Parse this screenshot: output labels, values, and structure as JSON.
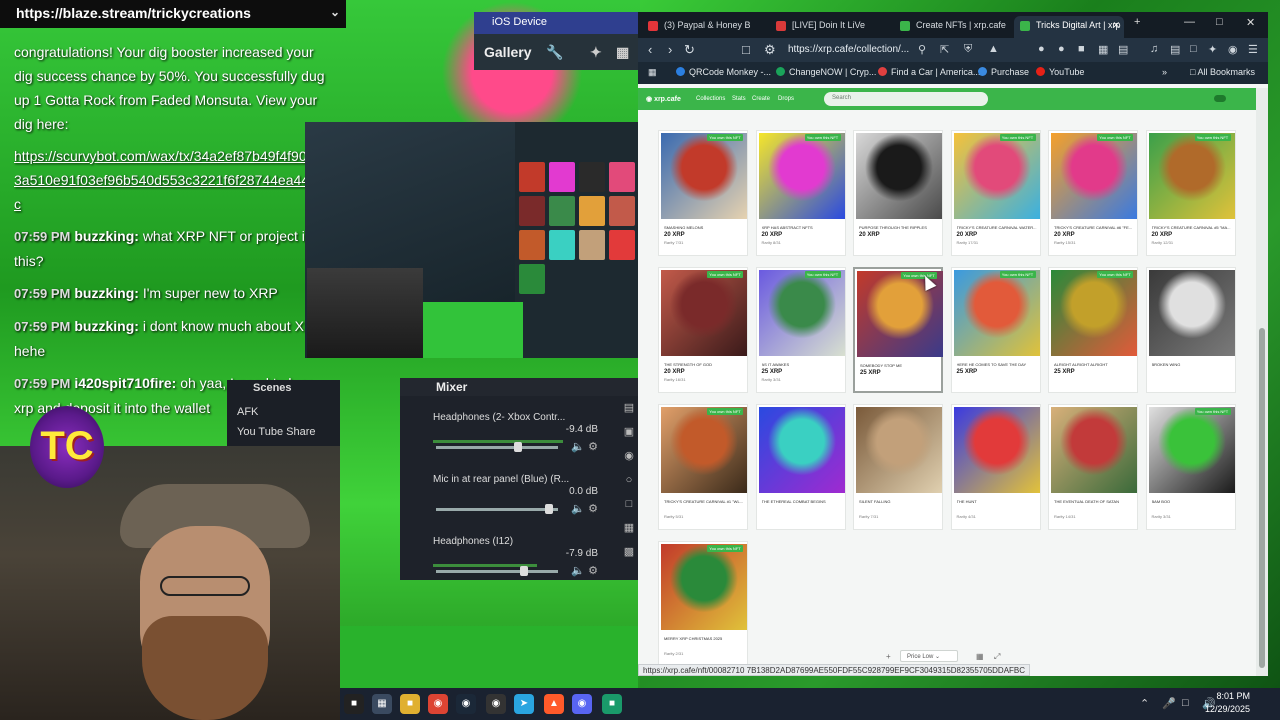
{
  "stream": {
    "top_url": "https://blaze.stream/trickycreations",
    "chat": [
      {
        "time": "",
        "user": "",
        "text": "congratulations! Your dig booster increased your dig success chance by 50%. You successfully dug up 1 Gotta Rock from Faded Monsuta. View your dig here:"
      },
      {
        "time": "",
        "user": "",
        "text": "https://scurvybot.com/wax/tx/34a2ef87b49f4f905683a510e91f03ef96b540d553c3221f6f28744ea44803c"
      },
      {
        "time": "07:59 PM",
        "user": "buzzking:",
        "text": "what XRP NFT or project is this?"
      },
      {
        "time": "07:59 PM",
        "user": "buzzking:",
        "text": "I'm super new to XRP"
      },
      {
        "time": "07:59 PM",
        "user": "buzzking:",
        "text": "i dont know much about XRP hehe"
      },
      {
        "time": "07:59 PM",
        "user": "i420spit710fire:",
        "text": "oh yaa, I need to buy xrp and deposit it into the wallet"
      }
    ],
    "ios_device_label": "iOS Device",
    "gallery_label": "Gallery",
    "scenes": {
      "title": "Scenes",
      "items": [
        "AFK",
        "You Tube Share"
      ]
    },
    "mixer": {
      "title": "Mixer",
      "channels": [
        {
          "name": "Headphones (2- Xbox Contr...",
          "db": "-9.4 dB",
          "level": 0.68
        },
        {
          "name": "Mic in at rear panel (Blue) (R...",
          "db": "0.0 dB",
          "level": 0.96
        },
        {
          "name": "Headphones (I12)",
          "db": "-7.9 dB",
          "level": 0.74
        }
      ]
    },
    "logo_text": "TC"
  },
  "browser": {
    "tabs": [
      {
        "label": "(3) Paypal & Honey B",
        "color": "#e2353a",
        "active": false
      },
      {
        "label": "[LIVE] Doin It LiVe",
        "color": "#d93a3a",
        "active": false
      },
      {
        "label": "Create NFTs | xrp.cafe",
        "color": "#3bb54a",
        "active": false
      },
      {
        "label": "Tricks Digital Art | xrp",
        "color": "#3bb54a",
        "active": true
      }
    ],
    "url": "https://xrp.cafe/collection/...",
    "bookmarks": [
      {
        "label": "QRCode Monkey -...",
        "color": "#2b7fe0"
      },
      {
        "label": "ChangeNOW | Cryp...",
        "color": "#1aa35a"
      },
      {
        "label": "Find a Car | America...",
        "color": "#e04040"
      },
      {
        "label": "Purchase",
        "color": "#3a8ae0"
      },
      {
        "label": "YouTube",
        "color": "#e62117"
      }
    ],
    "all_bookmarks": "All Bookmarks",
    "site": {
      "brand": "xrp.cafe",
      "nav": [
        "Collections",
        "Stats",
        "Create",
        "Drops"
      ],
      "search_placeholder": "Search"
    },
    "badge_text": "You own this NFT",
    "nfts": [
      {
        "name": "SMASHING MELONS",
        "price": "20 XRP",
        "rank": "Rarity 7/31",
        "colors": [
          "#c23a2a",
          "#3a6ab0",
          "#e6d2b0"
        ],
        "owned": true
      },
      {
        "name": "XRP HAS ABSTRACT NFTS",
        "price": "20 XRP",
        "rank": "Rarity 8/31",
        "colors": [
          "#e23ad0",
          "#f5e62a",
          "#2a4ae0"
        ],
        "owned": true
      },
      {
        "name": "PURPOSE THROUGH THE RIPPLES",
        "price": "20 XRP",
        "rank": "",
        "colors": [
          "#1a1a1a",
          "#d8d8d8",
          "#4a4a4a"
        ],
        "owned": false
      },
      {
        "name": "TRICKY'S CREATURE CARNIVAL WATER...",
        "price": "20 XRP",
        "rank": "Rarity 17/31",
        "colors": [
          "#e24a7a",
          "#f5c23a",
          "#3ab0e0"
        ],
        "owned": true
      },
      {
        "name": "TRICKY'S CREATURE CARNIVAL #6 \"FE...",
        "price": "20 XRP",
        "rank": "Rarity 15/31",
        "colors": [
          "#e23a8a",
          "#f5a02a",
          "#3a7ae0"
        ],
        "owned": true
      },
      {
        "name": "TRICKY'S CREATURE CARNIVAL #5 \"MA...",
        "price": "20 XRP",
        "rank": "Rarity 12/31",
        "colors": [
          "#b06a2a",
          "#3aa04a",
          "#e0c23a"
        ],
        "owned": true
      },
      {
        "name": "THE STRENGTH OF GOD",
        "price": "20 XRP",
        "rank": "Rarity 16/31",
        "colors": [
          "#7a2a2a",
          "#c25a4a",
          "#3a1a1a"
        ],
        "owned": true
      },
      {
        "name": "AS IT AWAKES",
        "price": "25 XRP",
        "rank": "Rarity 3/31",
        "colors": [
          "#3a8a4a",
          "#6a5ae0",
          "#d8e0d0"
        ],
        "owned": true
      },
      {
        "name": "SOMEBODY STOP ME",
        "price": "25 XRP",
        "rank": "",
        "colors": [
          "#e2a03a",
          "#c23a2a",
          "#3a3a8a"
        ],
        "owned": true
      },
      {
        "name": "HERE HE COMES TO SAVE THE DAY",
        "price": "25 XRP",
        "rank": "",
        "colors": [
          "#e25a3a",
          "#3a9ae0",
          "#e0c23a"
        ],
        "owned": true
      },
      {
        "name": "ALRIGHT ALRIGHT ALRIGHT",
        "price": "25 XRP",
        "rank": "",
        "colors": [
          "#c2a02a",
          "#2a8a3a",
          "#e25a3a"
        ],
        "owned": true
      },
      {
        "name": "BROKEN WING",
        "price": "",
        "rank": "",
        "colors": [
          "#e0e0e0",
          "#3a3a3a",
          "#7a7a7a"
        ],
        "owned": false
      },
      {
        "name": "TRICKY'S CREATURE CARNIVAL #1 \"WL...",
        "price": "",
        "rank": "Rarity 5/31",
        "colors": [
          "#c25a2a",
          "#e2a06a",
          "#3a2a1a"
        ],
        "owned": true
      },
      {
        "name": "THE ETHEREAL COMBAT BEGINS",
        "price": "",
        "rank": "",
        "colors": [
          "#3ad0c2",
          "#2a4ae0",
          "#a02ad0"
        ],
        "owned": false
      },
      {
        "name": "SILENT FALLING",
        "price": "",
        "rank": "Rarity 7/31",
        "colors": [
          "#c2a07a",
          "#7a5a3a",
          "#e0d0b0"
        ],
        "owned": false
      },
      {
        "name": "THE HUNT",
        "price": "",
        "rank": "Rarity 4/31",
        "colors": [
          "#e23a3a",
          "#3a3ae0",
          "#e2c23a"
        ],
        "owned": false
      },
      {
        "name": "THE EVENTUAL DEATH OF SATAN",
        "price": "",
        "rank": "Rarity 14/31",
        "colors": [
          "#c23a3a",
          "#d8b07a",
          "#3a6a3a"
        ],
        "owned": false
      },
      {
        "name": "BAM BOO",
        "price": "",
        "rank": "Rarity 3/31",
        "colors": [
          "#3ac23a",
          "#e0e0e0",
          "#1a1a1a"
        ],
        "owned": true
      },
      {
        "name": "MERRY XRP CHRISTMAS 2025",
        "price": "",
        "rank": "Rarity 2/31",
        "colors": [
          "#2a8a3a",
          "#c23a2a",
          "#e0c23a"
        ],
        "owned": true
      }
    ],
    "sort_label": "Price Low",
    "status_url": "https://xrp.cafe/nft/00082710 7B138D2AD87699AE550FDF55C928799EF9CF3049315D82355705DDAFBC"
  },
  "taskbar": {
    "time": "8:01 PM",
    "date": "12/29/2025"
  }
}
